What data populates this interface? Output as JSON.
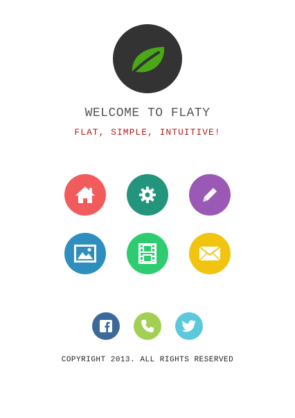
{
  "header": {
    "title": "WELCOME TO FLATY",
    "subtitle": "FLAT, SIMPLE, INTUITIVE!",
    "logo_icon": "leaf-icon",
    "logo_bg": "#333333",
    "leaf_color": "#4aa818"
  },
  "tiles": [
    {
      "name": "home",
      "icon": "home-icon",
      "color": "#f25b5b"
    },
    {
      "name": "settings",
      "icon": "gear-icon",
      "color": "#23957c"
    },
    {
      "name": "edit",
      "icon": "pencil-icon",
      "color": "#9b59b6"
    },
    {
      "name": "gallery",
      "icon": "image-icon",
      "color": "#2e8fbf"
    },
    {
      "name": "video",
      "icon": "film-icon",
      "color": "#2ecc71"
    },
    {
      "name": "mail",
      "icon": "mail-icon",
      "color": "#f1c40f"
    }
  ],
  "social": [
    {
      "name": "facebook",
      "icon": "facebook-icon",
      "color": "#3b6a9a"
    },
    {
      "name": "phone",
      "icon": "phone-icon",
      "color": "#a3d054"
    },
    {
      "name": "twitter",
      "icon": "twitter-icon",
      "color": "#5bc8dc"
    }
  ],
  "footer": {
    "copyright": "COPYRIGHT 2013. ALL RIGHTS RESERVED"
  }
}
